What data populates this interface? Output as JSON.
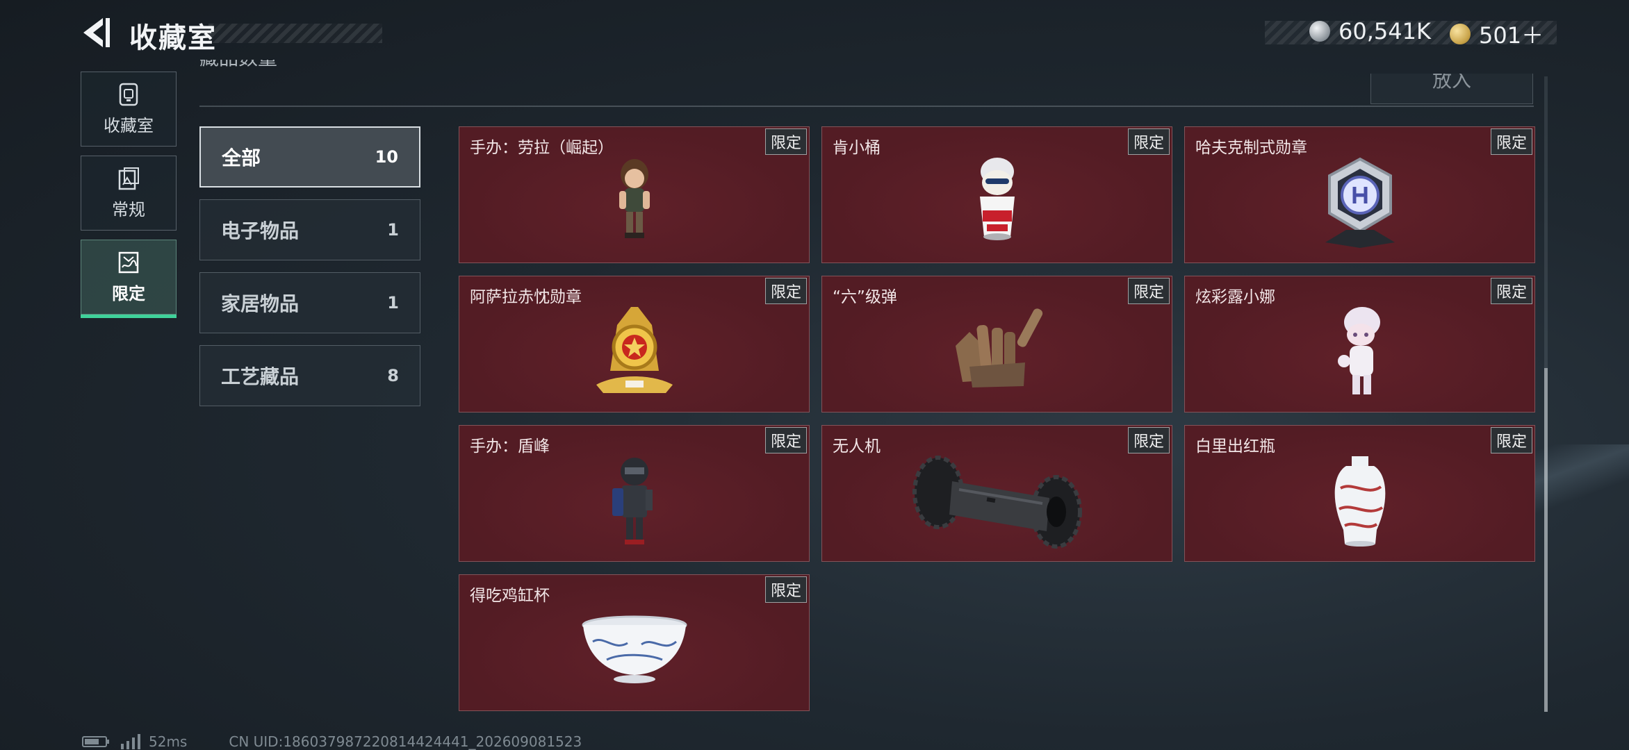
{
  "header": {
    "title": "收藏室",
    "currencies": [
      {
        "icon": "silver-coin-icon",
        "value": "60,541K"
      },
      {
        "icon": "gold-coin-icon",
        "value": "501＋"
      }
    ]
  },
  "side_nav": [
    {
      "label": "收藏室",
      "icon": "cabinet-icon",
      "active": false
    },
    {
      "label": "常规",
      "icon": "frame-icon",
      "active": false
    },
    {
      "label": "限定",
      "icon": "limited-frame-icon",
      "active": true
    }
  ],
  "content": {
    "cut_heading": "藏品数量",
    "put_button": "放入"
  },
  "categories": [
    {
      "name": "全部",
      "count": "10",
      "active": true
    },
    {
      "name": "电子物品",
      "count": "1",
      "active": false
    },
    {
      "name": "家居物品",
      "count": "1",
      "active": false
    },
    {
      "name": "工艺藏品",
      "count": "8",
      "active": false
    }
  ],
  "items": [
    {
      "name": "手办：劳拉（崛起）",
      "badge": "限定",
      "art": "figure-lara-icon"
    },
    {
      "name": "肯小桶",
      "badge": "限定",
      "art": "bucket-figure-icon"
    },
    {
      "name": "哈夫克制式勋章",
      "badge": "限定",
      "art": "hexagon-medal-icon"
    },
    {
      "name": "阿萨拉赤忱勋章",
      "badge": "限定",
      "art": "gold-medal-icon"
    },
    {
      "name": "“六”级弹",
      "badge": "限定",
      "art": "bullet-hand-icon"
    },
    {
      "name": "炫彩露小娜",
      "badge": "限定",
      "art": "white-doll-icon"
    },
    {
      "name": "手办：盾峰",
      "badge": "限定",
      "art": "figure-shield-icon"
    },
    {
      "name": "无人机",
      "badge": "限定",
      "art": "drone-roller-icon"
    },
    {
      "name": "白里出红瓶",
      "badge": "限定",
      "art": "porcelain-vase-icon"
    },
    {
      "name": "得吃鸡缸杯",
      "badge": "限定",
      "art": "porcelain-cup-icon"
    }
  ],
  "footer": {
    "ping": "52ms",
    "uid": "CN UID:186037987220814424441_202609081523"
  }
}
